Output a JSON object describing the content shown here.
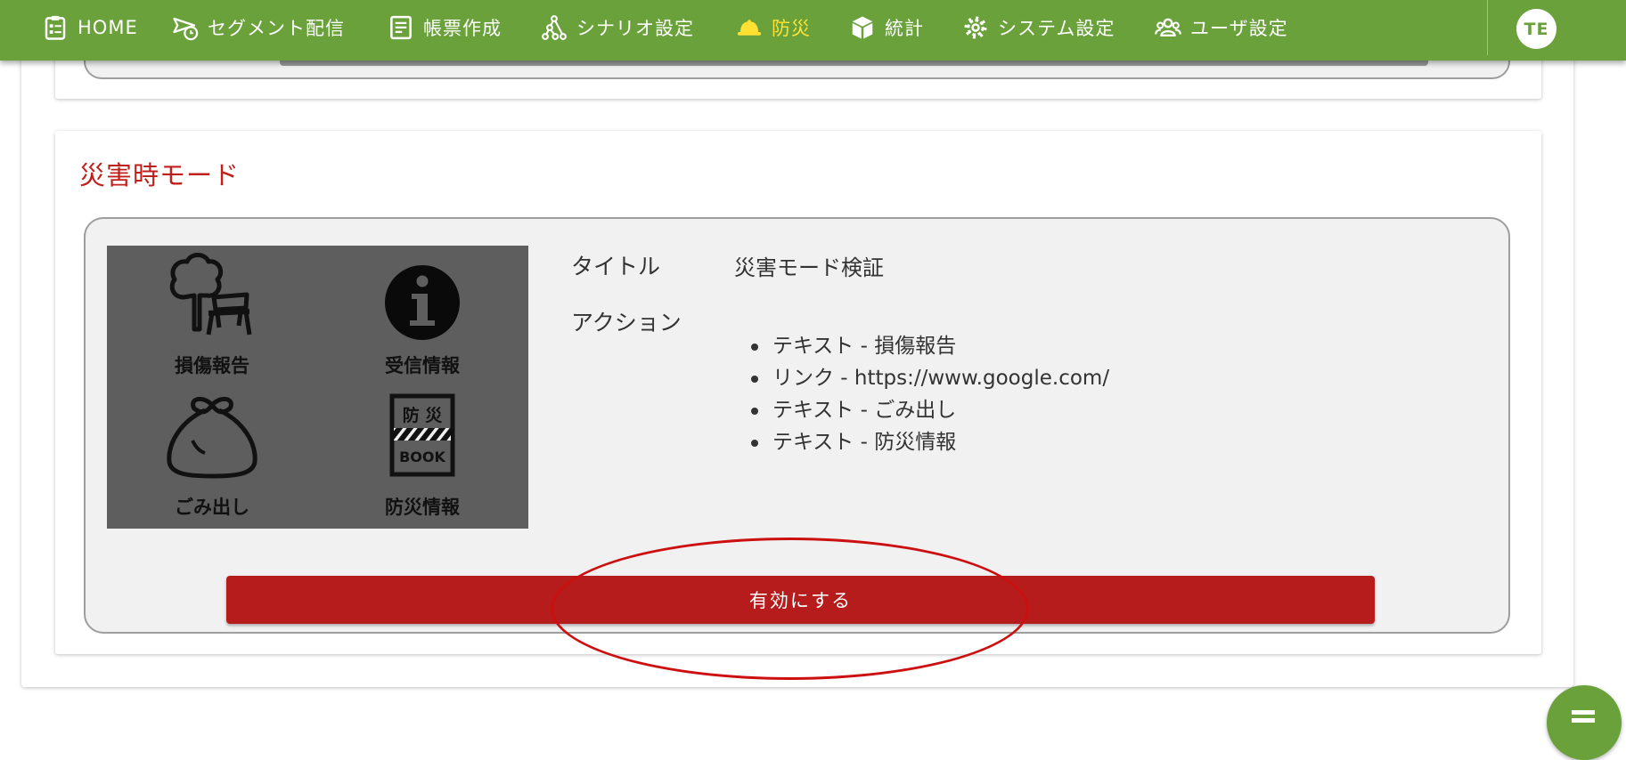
{
  "navbar": {
    "items": [
      {
        "label": "HOME",
        "icon": "clipboard-list-icon"
      },
      {
        "label": "セグメント配信",
        "icon": "send-clock-icon"
      },
      {
        "label": "帳票作成",
        "icon": "form-document-icon"
      },
      {
        "label": "シナリオ設定",
        "icon": "scenario-tree-icon"
      },
      {
        "label": "防災",
        "icon": "hard-hat-icon",
        "active": true
      },
      {
        "label": "統計",
        "icon": "cube-icon"
      },
      {
        "label": "システム設定",
        "icon": "gear-icon"
      },
      {
        "label": "ユーザ設定",
        "icon": "users-icon"
      }
    ],
    "avatar_initials": "TE",
    "background_color": "#6aa13b",
    "active_color": "#ffe033"
  },
  "disaster_mode": {
    "section_title": "災害時モード",
    "title_label": "タイトル",
    "title_value": "災害モード検証",
    "actions_label": "アクション",
    "actions": [
      "テキスト - 損傷報告",
      "リンク - https://www.google.com/",
      "テキスト - ごみ出し",
      "テキスト - 防災情報"
    ],
    "menu_image": {
      "cells": [
        {
          "label": "損傷報告",
          "icon": "tree-bench-icon"
        },
        {
          "label": "受信情報",
          "icon": "info-circle-icon"
        },
        {
          "label": "ごみ出し",
          "icon": "garbage-bag-icon"
        },
        {
          "label": "防災情報",
          "icon": "disaster-book-icon",
          "book_text_top": "防 災",
          "book_text_bottom": "BOOK"
        }
      ]
    },
    "enable_button_label": "有効にする",
    "accent_color": "#b71c1c"
  }
}
